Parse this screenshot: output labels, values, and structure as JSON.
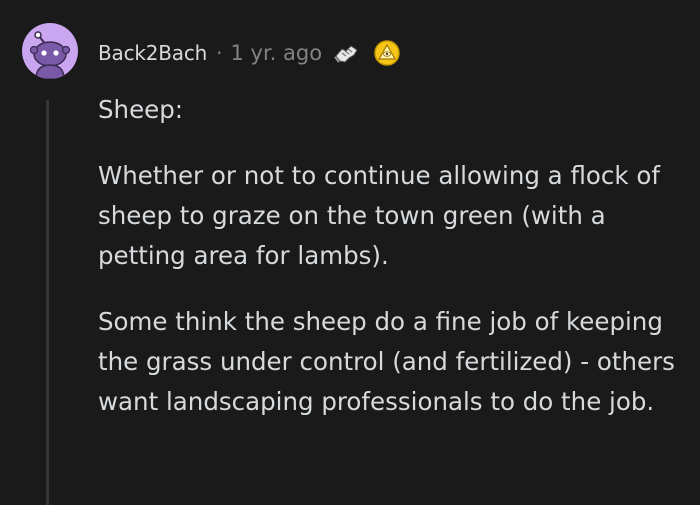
{
  "comment": {
    "avatar_icon": "snoo-avatar-icon",
    "username": "Back2Bach",
    "separator": "·",
    "timestamp": "1 yr. ago",
    "awards": [
      "hands-shake-award-icon",
      "gold-triangle-award-icon"
    ],
    "paragraphs": [
      "Sheep:",
      "Whether or not to continue allowing a flock of sheep to graze on the town green (with a petting area for lambs).",
      "Some think the sheep do a fine job of keeping the grass under control (and fertilized) - others want landscaping professionals to do the job."
    ]
  },
  "colors": {
    "background": "#1a1a1b",
    "text": "#d7dadc",
    "meta": "#818384",
    "thread_line": "#343536",
    "avatar_bg": "#c9a6ef"
  }
}
